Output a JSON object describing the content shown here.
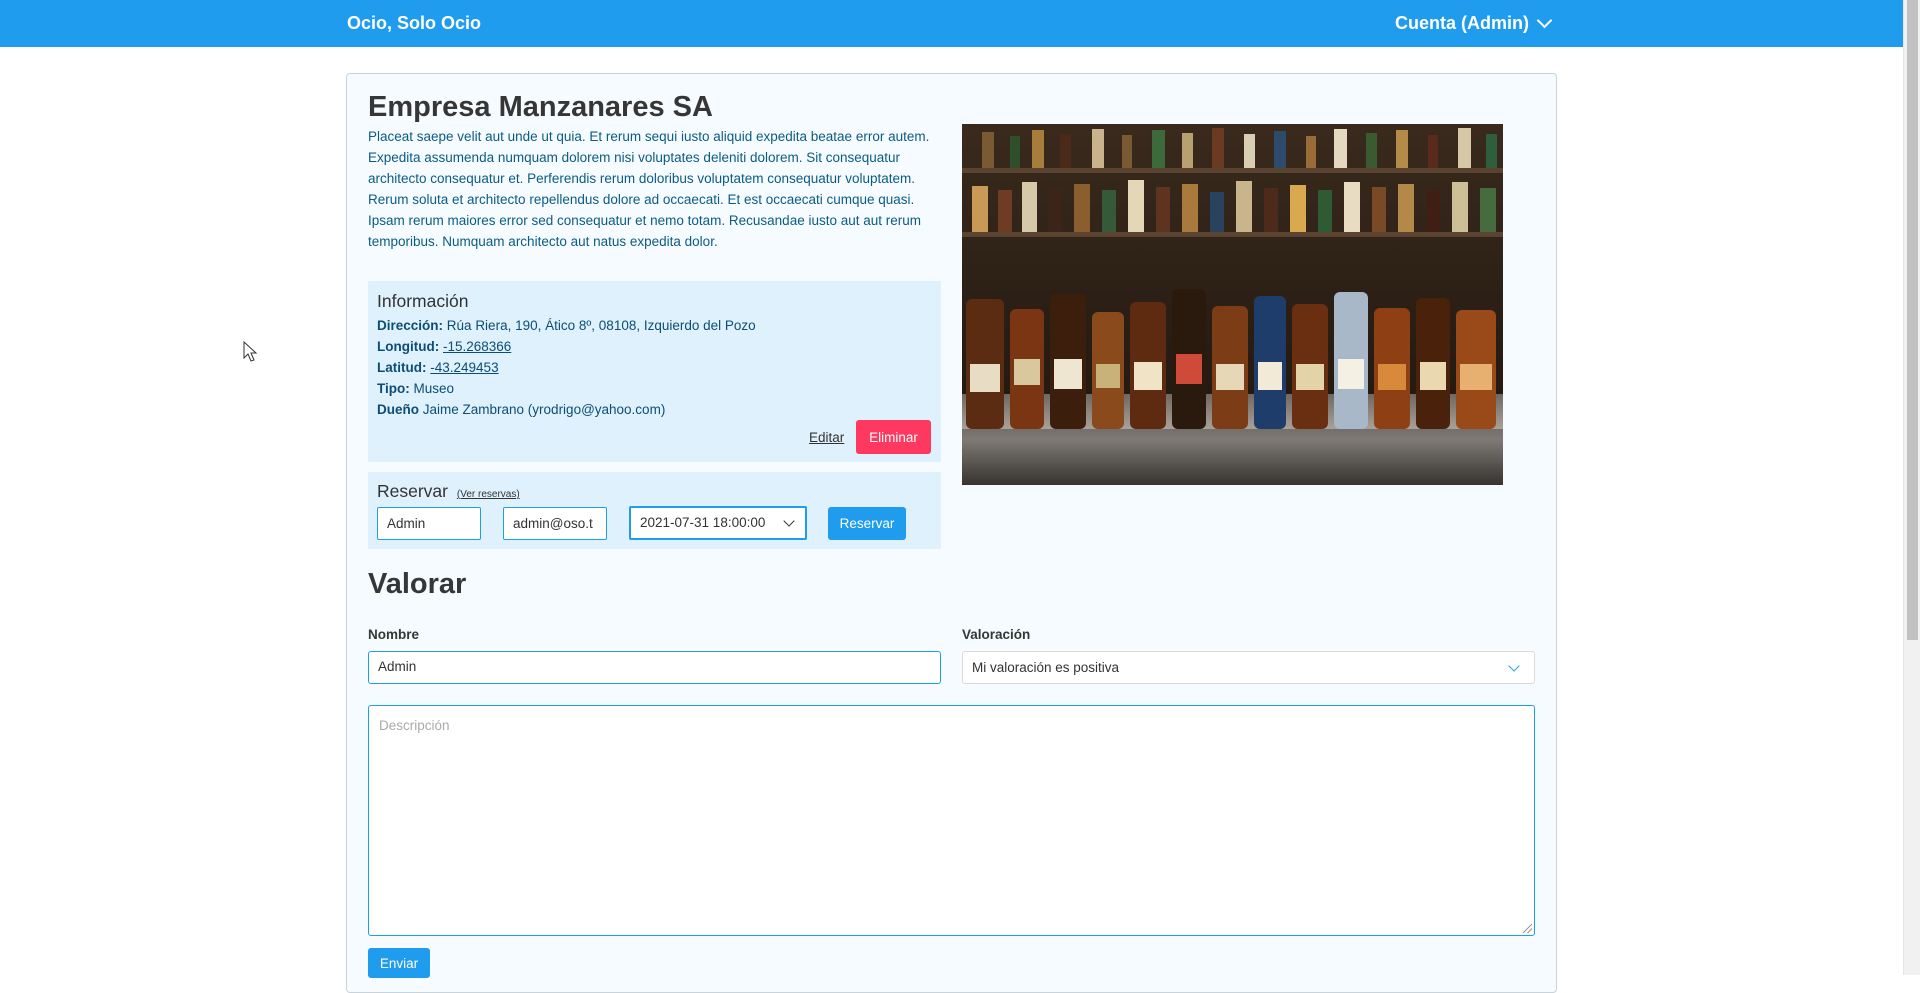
{
  "navbar": {
    "brand": "Ocio, Solo Ocio",
    "account": "Cuenta (Admin)"
  },
  "place": {
    "title": "Empresa Manzanares SA",
    "description": "Placeat saepe velit aut unde ut quia. Et rerum sequi iusto aliquid expedita beatae error autem. Expedita assumenda numquam dolorem nisi voluptates deleniti dolorem. Sit consequatur architecto consequatur et. Perferendis rerum doloribus voluptatem consequatur voluptatem. Rerum soluta et architecto repellendus dolore ad occaecati. Et est occaecati cumque quasi. Ipsam rerum maiores error sed consequatur et nemo totam. Recusandae iusto aut aut rerum temporibus. Numquam architecto aut natus expedita dolor.",
    "photo_icon": "bottles-photo"
  },
  "info": {
    "title": "Información",
    "address_label": "Dirección:",
    "address": "Rúa Riera, 190, Ático 8º, 08108, Izquierdo del Pozo",
    "longitude_label": "Longitud:",
    "longitude": "-15.268366",
    "latitude_label": "Latitud:",
    "latitude": "-43.249453",
    "type_label": "Tipo:",
    "type": "Museo",
    "owner_label": "Dueño",
    "owner": "Jaime Zambrano (yrodrigo@yahoo.com)",
    "edit_label": "Editar",
    "delete_label": "Eliminar"
  },
  "reserve": {
    "title": "Reservar",
    "view_link": "(Ver reservas)",
    "name_value": "Admin",
    "email_value": "admin@oso.t",
    "datetime_value": "2021-07-31 18:00:00",
    "button_label": "Reservar"
  },
  "review": {
    "heading": "Valorar",
    "name_label": "Nombre",
    "name_value": "Admin",
    "rating_label": "Valoración",
    "rating_value": "Mi valoración es positiva",
    "description_placeholder": "Descripción",
    "submit_label": "Enviar"
  },
  "colors": {
    "primary": "#209cee",
    "danger": "#ff3860",
    "info_bg": "#def1fc"
  }
}
